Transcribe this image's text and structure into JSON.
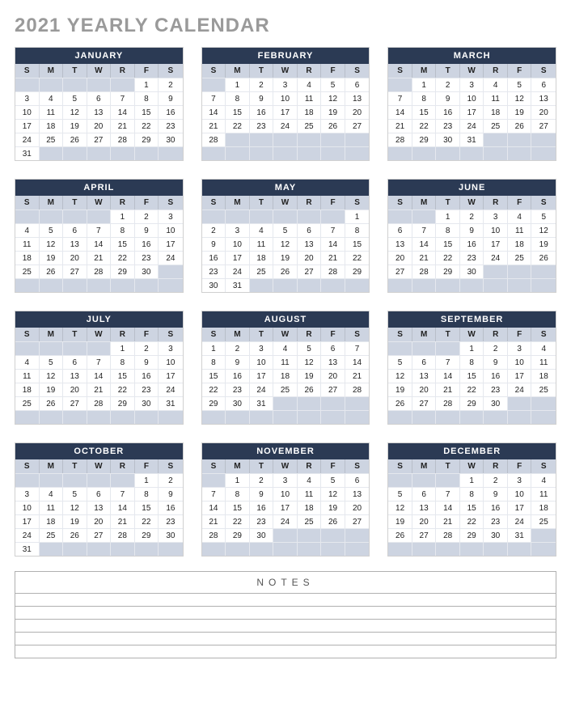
{
  "title": "2021 YEARLY CALENDAR",
  "dow": [
    "S",
    "M",
    "T",
    "W",
    "R",
    "F",
    "S"
  ],
  "notes_label": "NOTES",
  "notes_lines": 5,
  "months": [
    {
      "name": "JANUARY",
      "start": 5,
      "days": 31
    },
    {
      "name": "FEBRUARY",
      "start": 1,
      "days": 28
    },
    {
      "name": "MARCH",
      "start": 1,
      "days": 31
    },
    {
      "name": "APRIL",
      "start": 4,
      "days": 30
    },
    {
      "name": "MAY",
      "start": 6,
      "days": 31
    },
    {
      "name": "JUNE",
      "start": 2,
      "days": 30
    },
    {
      "name": "JULY",
      "start": 4,
      "days": 31
    },
    {
      "name": "AUGUST",
      "start": 0,
      "days": 31
    },
    {
      "name": "SEPTEMBER",
      "start": 3,
      "days": 30
    },
    {
      "name": "OCTOBER",
      "start": 5,
      "days": 31
    },
    {
      "name": "NOVEMBER",
      "start": 1,
      "days": 30
    },
    {
      "name": "DECEMBER",
      "start": 3,
      "days": 31
    }
  ]
}
